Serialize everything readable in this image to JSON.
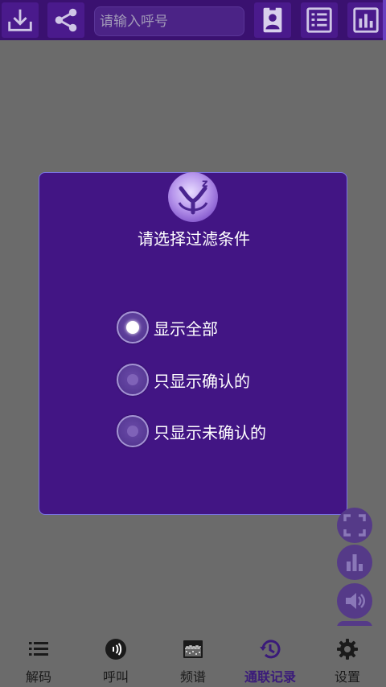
{
  "toolbar": {
    "search_placeholder": "请输入呼号",
    "buttons": [
      "download-icon",
      "share-icon",
      "contact-card-icon",
      "list-icon",
      "chart-icon"
    ]
  },
  "dialog": {
    "title": "请选择过滤条件",
    "options": [
      {
        "label": "显示全部",
        "checked": true
      },
      {
        "label": "只显示确认的",
        "checked": false
      },
      {
        "label": "只显示未确认的",
        "checked": false
      }
    ]
  },
  "side_buttons": [
    "fullscreen-icon",
    "bars-icon",
    "volume-icon"
  ],
  "bottom_nav": {
    "items": [
      {
        "label": "解码",
        "icon": "list-icon"
      },
      {
        "label": "呼叫",
        "icon": "signal-icon"
      },
      {
        "label": "频谱",
        "icon": "spectrum-icon"
      },
      {
        "label": "通联记录",
        "icon": "history-icon",
        "active": true
      },
      {
        "label": "设置",
        "icon": "gear-icon"
      }
    ]
  },
  "colors": {
    "accent": "#421584",
    "toolbar": "#3a1170",
    "dim": "#6b6b6b"
  }
}
